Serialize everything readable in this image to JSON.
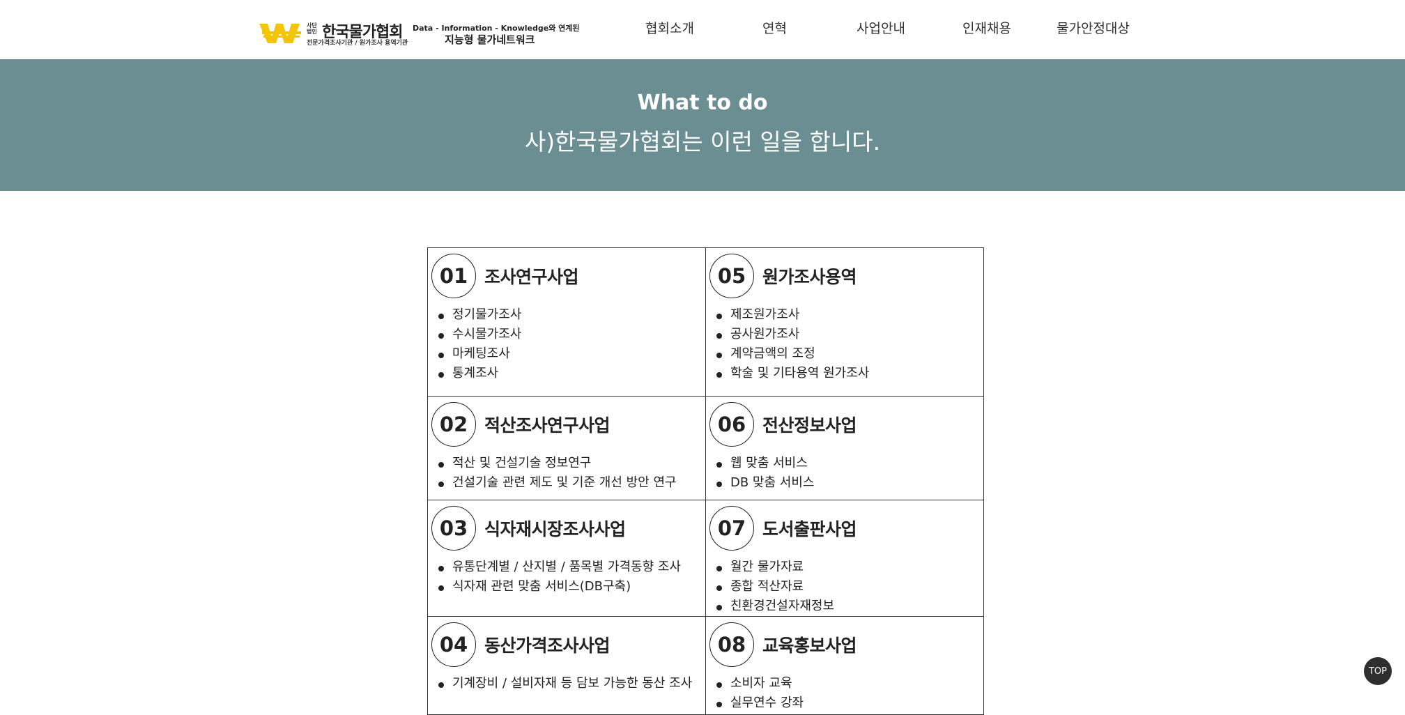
{
  "header": {
    "logo": {
      "small_label": "사단법인",
      "name": "한국물가협회",
      "sub": "전문가격조사기관 / 원가조사 용역기관",
      "tagline1": "Data - Information - Knowledge와 연계된",
      "tagline2": "지능형 물가네트워크"
    },
    "nav": [
      "협회소개",
      "연혁",
      "사업안내",
      "인재채용",
      "물가안정대상"
    ]
  },
  "banner": {
    "title": "What to do",
    "subtitle": "사)한국물가협회는 이런 일을 합니다."
  },
  "services": {
    "rows": [
      [
        {
          "num": "01",
          "title": "조사연구사업",
          "items": [
            "정기물가조사",
            "수시물가조사",
            "마케팅조사",
            "통계조사"
          ]
        },
        {
          "num": "05",
          "title": "원가조사용역",
          "items": [
            "제조원가조사",
            "공사원가조사",
            "계약금액의 조정",
            "학술 및 기타용역 원가조사"
          ]
        }
      ],
      [
        {
          "num": "02",
          "title": "적산조사연구사업",
          "items": [
            "적산 및 건설기술 정보연구",
            "건설기술 관련 제도 및 기준 개선 방안 연구"
          ]
        },
        {
          "num": "06",
          "title": "전산정보사업",
          "items": [
            "웹 맞춤 서비스",
            "DB 맞춤 서비스"
          ]
        }
      ],
      [
        {
          "num": "03",
          "title": "식자재시장조사사업",
          "items": [
            "유통단계별 / 산지별 / 품목별 가격동향 조사",
            "식자재 관련 맞춤 서비스(DB구축)"
          ]
        },
        {
          "num": "07",
          "title": "도서출판사업",
          "items": [
            "월간 물가자료",
            "종합 적산자료",
            "친환경건설자재정보"
          ]
        }
      ],
      [
        {
          "num": "04",
          "title": "동산가격조사사업",
          "items": [
            "기계장비 / 설비자재 등 담보 가능한 동산 조사"
          ]
        },
        {
          "num": "08",
          "title": "교육홍보사업",
          "items": [
            "소비자 교육",
            "실무연수 강좌"
          ]
        }
      ]
    ]
  },
  "top_button": "TOP",
  "colors": {
    "banner": "#6b8e93",
    "logo_yellow": "#f2c500"
  }
}
